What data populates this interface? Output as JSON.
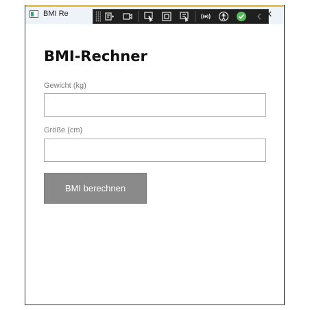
{
  "window": {
    "title": "BMI Re",
    "close_symbol": "✕"
  },
  "toolbar": {
    "icons": [
      "live-visual-tree-icon",
      "record-icon",
      "select-element-icon",
      "display-layout-adorners-icon",
      "track-focused-element-icon",
      "hot-reload-icon",
      "accessibility-icon",
      "check-status-icon",
      "collapse-toolbar-icon"
    ],
    "accent_color": "#e8c13a"
  },
  "page": {
    "heading": "BMI-Rechner",
    "weight_label": "Gewicht (kg)",
    "weight_value": "",
    "height_label": "Größe (cm)",
    "height_value": "",
    "button_label": "BMI berechnen",
    "button_color": "#8a8a8a"
  }
}
